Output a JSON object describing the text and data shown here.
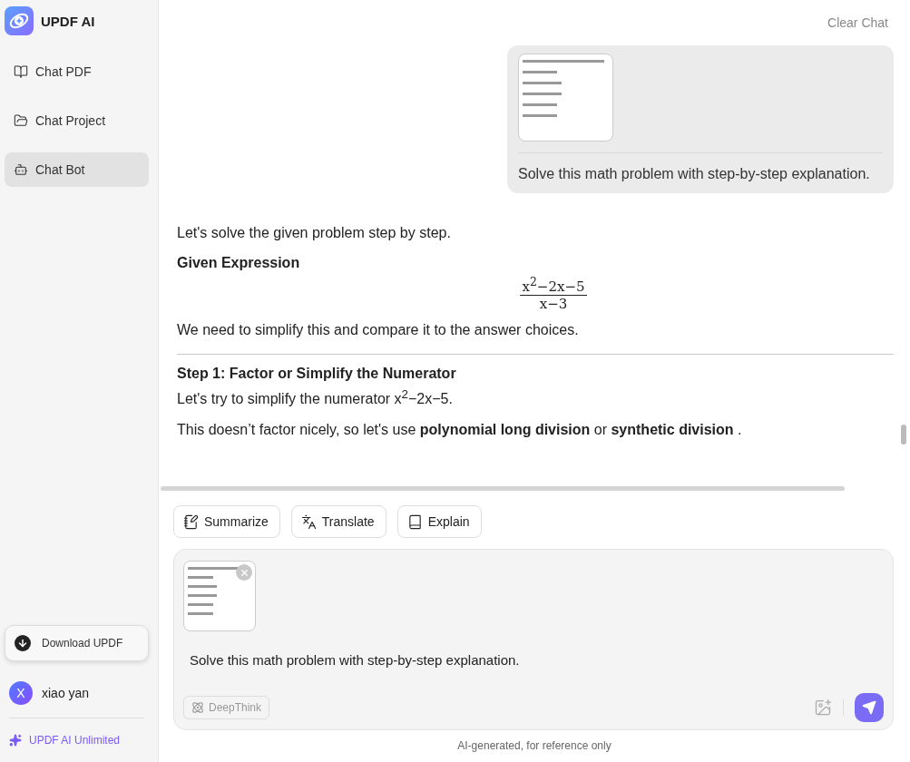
{
  "sidebar": {
    "logo_text": "UPDF AI",
    "items": [
      {
        "label": "Chat PDF",
        "kind": "pdf",
        "selected": false
      },
      {
        "label": "Chat Project",
        "kind": "project",
        "selected": false
      },
      {
        "label": "Chat Bot",
        "kind": "bot",
        "selected": true
      }
    ],
    "download_button": "Download UPDF",
    "user": {
      "avatar_letter": "X",
      "name": "xiao yan"
    },
    "plan_link": "UPDF AI Unlimited"
  },
  "header": {
    "clear_button": "Clear Chat"
  },
  "messages": [
    {
      "kind": "user",
      "text": "Solve this math problem with step-by-step explanation."
    },
    {
      "kind": "assistant",
      "blocks": [
        {
          "kind": "paragraph",
          "text": "Let's solve the given problem step by step."
        },
        {
          "kind": "heading",
          "text": "Given Expression"
        },
        {
          "kind": "formula",
          "numerator": "x$^{2}$−2x−5",
          "denominator": "x−3"
        },
        {
          "kind": "paragraph",
          "text": "We need to simplify this and compare it to the answer choices."
        },
        {
          "kind": "divider"
        },
        {
          "kind": "heading",
          "text": "Step 1: Factor or Simplify the Numerator"
        },
        {
          "kind": "paragraph",
          "text": "Let's try to simplify the numerator x$^{2}$−2x−5."
        },
        {
          "kind": "paragraph",
          "text": "This doesn’t factor nicely, so let's use **polynomial long division** or **synthetic division** ."
        }
      ]
    }
  ],
  "actions": [
    {
      "label": "Summarize",
      "kind": "summarize"
    },
    {
      "label": "Translate",
      "kind": "translate"
    },
    {
      "label": "Explain",
      "kind": "explain"
    }
  ],
  "composer": {
    "value": "Solve this math problem with step-by-step explanation.",
    "deepthink_button": "DeepThink"
  },
  "footer_note": "AI-generated, for reference only"
}
